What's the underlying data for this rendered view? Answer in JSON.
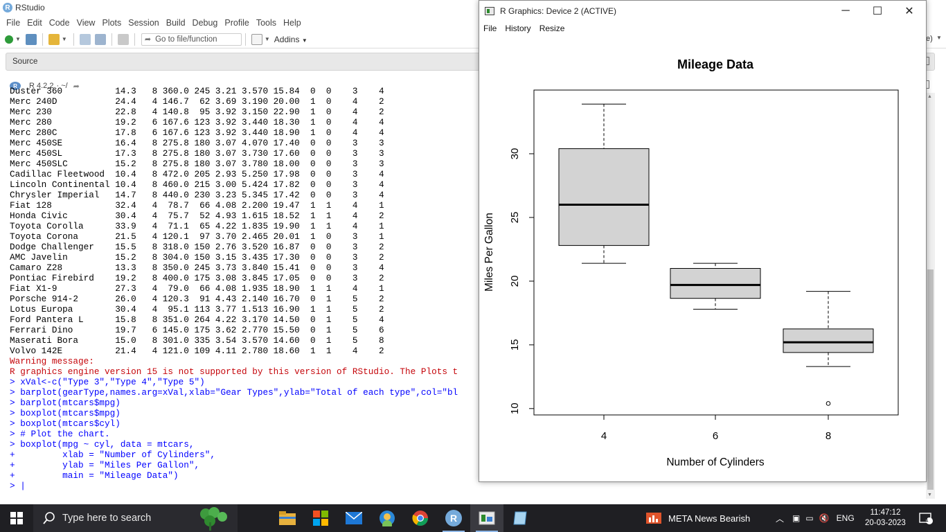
{
  "app": {
    "title": "RStudio",
    "logo_letter": "R"
  },
  "menubar": [
    "File",
    "Edit",
    "Code",
    "View",
    "Plots",
    "Session",
    "Build",
    "Debug",
    "Profile",
    "Tools",
    "Help"
  ],
  "toolbar": {
    "goto_placeholder": "Go to file/function",
    "addins_label": "Addins",
    "right_fragment": "e)"
  },
  "source_pane": {
    "label": "Source"
  },
  "console_header": {
    "version": "R 4.2.2",
    "path": "· ~/"
  },
  "console_lines": [
    {
      "cls": "out",
      "text": "Duster 360          14.3   8 360.0 245 3.21 3.570 15.84  0  0    3    4"
    },
    {
      "cls": "out",
      "text": "Merc 240D           24.4   4 146.7  62 3.69 3.190 20.00  1  0    4    2"
    },
    {
      "cls": "out",
      "text": "Merc 230            22.8   4 140.8  95 3.92 3.150 22.90  1  0    4    2"
    },
    {
      "cls": "out",
      "text": "Merc 280            19.2   6 167.6 123 3.92 3.440 18.30  1  0    4    4"
    },
    {
      "cls": "out",
      "text": "Merc 280C           17.8   6 167.6 123 3.92 3.440 18.90  1  0    4    4"
    },
    {
      "cls": "out",
      "text": "Merc 450SE          16.4   8 275.8 180 3.07 4.070 17.40  0  0    3    3"
    },
    {
      "cls": "out",
      "text": "Merc 450SL          17.3   8 275.8 180 3.07 3.730 17.60  0  0    3    3"
    },
    {
      "cls": "out",
      "text": "Merc 450SLC         15.2   8 275.8 180 3.07 3.780 18.00  0  0    3    3"
    },
    {
      "cls": "out",
      "text": "Cadillac Fleetwood  10.4   8 472.0 205 2.93 5.250 17.98  0  0    3    4"
    },
    {
      "cls": "out",
      "text": "Lincoln Continental 10.4   8 460.0 215 3.00 5.424 17.82  0  0    3    4"
    },
    {
      "cls": "out",
      "text": "Chrysler Imperial   14.7   8 440.0 230 3.23 5.345 17.42  0  0    3    4"
    },
    {
      "cls": "out",
      "text": "Fiat 128            32.4   4  78.7  66 4.08 2.200 19.47  1  1    4    1"
    },
    {
      "cls": "out",
      "text": "Honda Civic         30.4   4  75.7  52 4.93 1.615 18.52  1  1    4    2"
    },
    {
      "cls": "out",
      "text": "Toyota Corolla      33.9   4  71.1  65 4.22 1.835 19.90  1  1    4    1"
    },
    {
      "cls": "out",
      "text": "Toyota Corona       21.5   4 120.1  97 3.70 2.465 20.01  1  0    3    1"
    },
    {
      "cls": "out",
      "text": "Dodge Challenger    15.5   8 318.0 150 2.76 3.520 16.87  0  0    3    2"
    },
    {
      "cls": "out",
      "text": "AMC Javelin         15.2   8 304.0 150 3.15 3.435 17.30  0  0    3    2"
    },
    {
      "cls": "out",
      "text": "Camaro Z28          13.3   8 350.0 245 3.73 3.840 15.41  0  0    3    4"
    },
    {
      "cls": "out",
      "text": "Pontiac Firebird    19.2   8 400.0 175 3.08 3.845 17.05  0  0    3    2"
    },
    {
      "cls": "out",
      "text": "Fiat X1-9           27.3   4  79.0  66 4.08 1.935 18.90  1  1    4    1"
    },
    {
      "cls": "out",
      "text": "Porsche 914-2       26.0   4 120.3  91 4.43 2.140 16.70  0  1    5    2"
    },
    {
      "cls": "out",
      "text": "Lotus Europa        30.4   4  95.1 113 3.77 1.513 16.90  1  1    5    2"
    },
    {
      "cls": "out",
      "text": "Ford Pantera L      15.8   8 351.0 264 4.22 3.170 14.50  0  1    5    4"
    },
    {
      "cls": "out",
      "text": "Ferrari Dino        19.7   6 145.0 175 3.62 2.770 15.50  0  1    5    6"
    },
    {
      "cls": "out",
      "text": "Maserati Bora       15.0   8 301.0 335 3.54 3.570 14.60  0  1    5    8"
    },
    {
      "cls": "out",
      "text": "Volvo 142E          21.4   4 121.0 109 4.11 2.780 18.60  1  1    4    2"
    },
    {
      "cls": "err",
      "text": "Warning message:"
    },
    {
      "cls": "err",
      "text": "R graphics engine version 15 is not supported by this version of RStudio. The Plots t"
    },
    {
      "cls": "cmd",
      "text": "> xVal<-c(\"Type 3\",\"Type 4\",\"Type 5\")"
    },
    {
      "cls": "cmd",
      "text": "> barplot(gearType,names.arg=xVal,xlab=\"Gear Types\",ylab=\"Total of each type\",col=\"bl"
    },
    {
      "cls": "cmd",
      "text": "> barplot(mtcars$mpg)"
    },
    {
      "cls": "cmd",
      "text": "> boxplot(mtcars$mpg)"
    },
    {
      "cls": "cmd",
      "text": "> boxplot(mtcars$cyl)"
    },
    {
      "cls": "cmd",
      "text": "> # Plot the chart."
    },
    {
      "cls": "cmd",
      "text": "> boxplot(mpg ~ cyl, data = mtcars,"
    },
    {
      "cls": "cmd",
      "text": "+         xlab = \"Number of Cylinders\","
    },
    {
      "cls": "cmd",
      "text": "+         ylab = \"Miles Per Gallon\","
    },
    {
      "cls": "cmd",
      "text": "+         main = \"Mileage Data\")"
    },
    {
      "cls": "cmd",
      "text": "> |"
    }
  ],
  "graphics_window": {
    "title": "R Graphics: Device 2 (ACTIVE)",
    "menu": [
      "File",
      "History",
      "Resize"
    ]
  },
  "chart_data": {
    "type": "boxplot",
    "title": "Mileage Data",
    "xlabel": "Number of Cylinders",
    "ylabel": "Miles Per Gallon",
    "categories": [
      "4",
      "6",
      "8"
    ],
    "ylim": [
      9.5,
      35.0
    ],
    "yticks": [
      10,
      15,
      20,
      25,
      30
    ],
    "boxes": [
      {
        "category": "4",
        "whisker_low": 21.4,
        "q1": 22.8,
        "median": 26.0,
        "q3": 30.4,
        "whisker_high": 33.9,
        "outliers": []
      },
      {
        "category": "6",
        "whisker_low": 17.8,
        "q1": 18.65,
        "median": 19.7,
        "q3": 21.0,
        "whisker_high": 21.4,
        "outliers": []
      },
      {
        "category": "8",
        "whisker_low": 13.3,
        "q1": 14.4,
        "median": 15.2,
        "q3": 16.25,
        "whisker_high": 19.2,
        "outliers": [
          10.4
        ]
      }
    ],
    "box_color": "#d3d3d3"
  },
  "taskbar": {
    "search_placeholder": "Type here to search",
    "news": "META  News Bearish",
    "language": "ENG",
    "time": "11:47:12",
    "date": "20-03-2023",
    "notification_count": "1"
  }
}
